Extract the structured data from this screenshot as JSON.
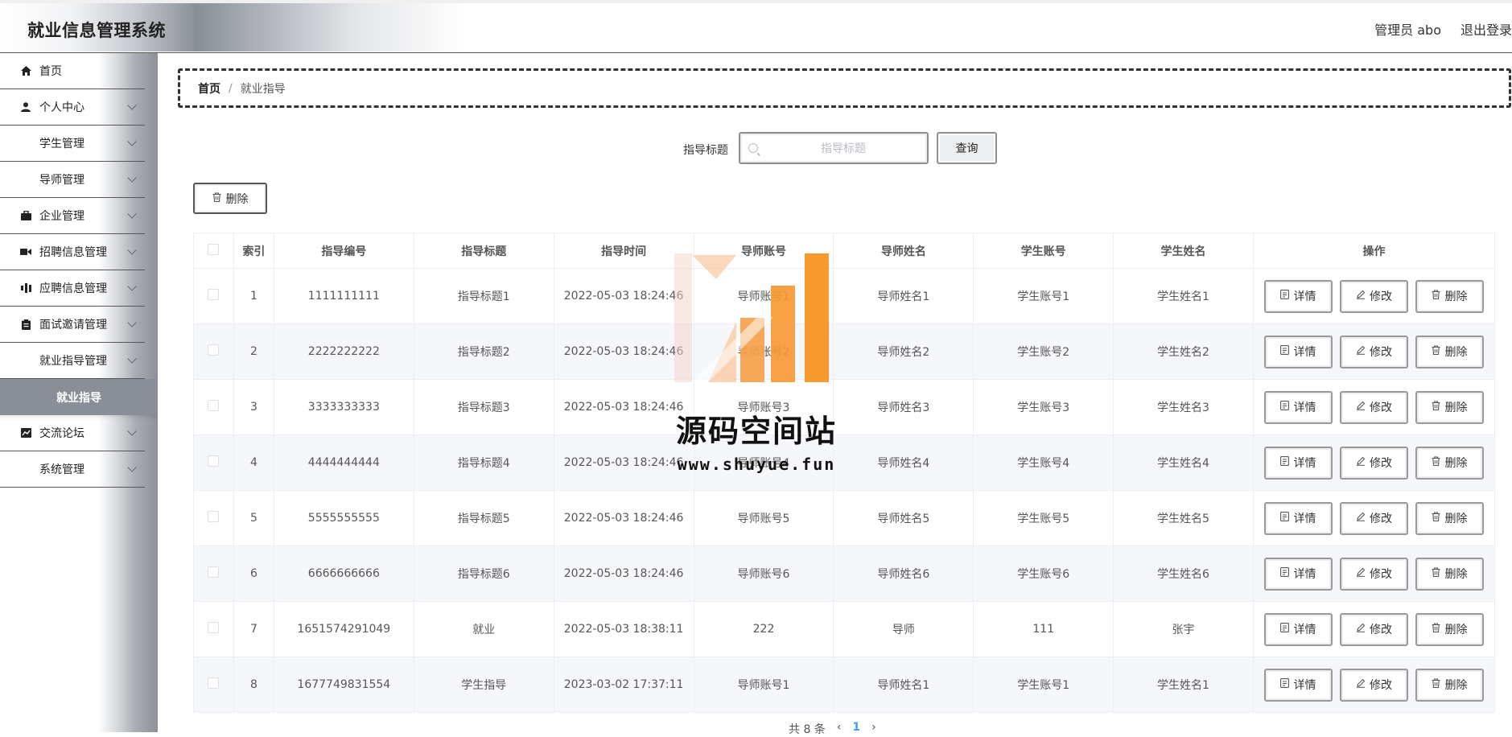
{
  "header": {
    "title": "就业信息管理系统",
    "user": "管理员 abo",
    "logout": "退出登录"
  },
  "sidebar": {
    "items": [
      {
        "label": "首页",
        "icon": "home-icon",
        "has_children": false
      },
      {
        "label": "个人中心",
        "icon": "user-icon",
        "has_children": true
      },
      {
        "label": "学生管理",
        "icon": "grid-icon",
        "has_children": true
      },
      {
        "label": "导师管理",
        "icon": "grid-icon",
        "has_children": true
      },
      {
        "label": "企业管理",
        "icon": "briefcase-icon",
        "has_children": true
      },
      {
        "label": "招聘信息管理",
        "icon": "video-icon",
        "has_children": true
      },
      {
        "label": "应聘信息管理",
        "icon": "bar-chart-icon",
        "has_children": true
      },
      {
        "label": "面试邀请管理",
        "icon": "clipboard-icon",
        "has_children": true
      },
      {
        "label": "就业指导管理",
        "icon": "grid-icon",
        "has_children": true
      },
      {
        "label": "交流论坛",
        "icon": "line-chart-icon",
        "has_children": true
      },
      {
        "label": "系统管理",
        "icon": "grid-icon",
        "has_children": true
      }
    ],
    "active_submenu": "就业指导"
  },
  "breadcrumb": {
    "home": "首页",
    "separator": "/",
    "current": "就业指导"
  },
  "search": {
    "label": "指导标题",
    "placeholder": "指导标题",
    "value": "",
    "button": "查询"
  },
  "toolbar": {
    "delete_label": "删除"
  },
  "table": {
    "columns": [
      "索引",
      "指导编号",
      "指导标题",
      "指导时间",
      "导师账号",
      "导师姓名",
      "学生账号",
      "学生姓名",
      "操作"
    ],
    "rows": [
      [
        "1",
        "1111111111",
        "指导标题1",
        "2022-05-03 18:24:46",
        "导师账号1",
        "导师姓名1",
        "学生账号1",
        "学生姓名1"
      ],
      [
        "2",
        "2222222222",
        "指导标题2",
        "2022-05-03 18:24:46",
        "导师账号2",
        "导师姓名2",
        "学生账号2",
        "学生姓名2"
      ],
      [
        "3",
        "3333333333",
        "指导标题3",
        "2022-05-03 18:24:46",
        "导师账号3",
        "导师姓名3",
        "学生账号3",
        "学生姓名3"
      ],
      [
        "4",
        "4444444444",
        "指导标题4",
        "2022-05-03 18:24:46",
        "导师账号4",
        "导师姓名4",
        "学生账号4",
        "学生姓名4"
      ],
      [
        "5",
        "5555555555",
        "指导标题5",
        "2022-05-03 18:24:46",
        "导师账号5",
        "导师姓名5",
        "学生账号5",
        "学生姓名5"
      ],
      [
        "6",
        "6666666666",
        "指导标题6",
        "2022-05-03 18:24:46",
        "导师账号6",
        "导师姓名6",
        "学生账号6",
        "学生姓名6"
      ],
      [
        "7",
        "1651574291049",
        "就业",
        "2022-05-03 18:38:11",
        "222",
        "导师",
        "111",
        "张宇"
      ],
      [
        "8",
        "1677749831554",
        "学生指导",
        "2023-03-02 17:37:11",
        "导师账号1",
        "导师姓名1",
        "学生账号1",
        "学生姓名1"
      ]
    ],
    "actions": {
      "detail": "详情",
      "edit": "修改",
      "delete": "删除"
    }
  },
  "pagination": {
    "total": "共 8 条",
    "prev": "‹",
    "page": "1",
    "next": "›"
  },
  "watermark": {
    "title": "源码空间站",
    "url": "www.shuyue.fun"
  },
  "colors": {
    "accent_gray": "#8a8f97",
    "row_alt": "#f5f7fa",
    "border": "#ebeef5",
    "watermark_orange": "#f7931e"
  }
}
